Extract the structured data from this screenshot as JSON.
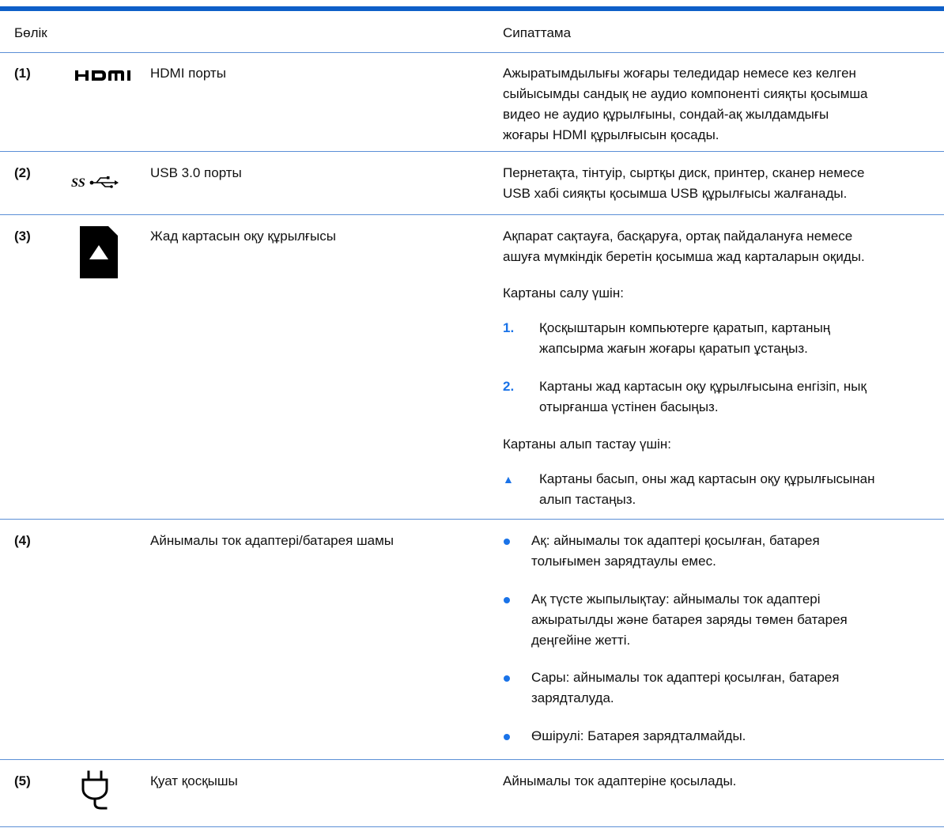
{
  "header": {
    "col_part": "Бөлік",
    "col_desc": "Сипаттама"
  },
  "rows": [
    {
      "num": "(1)",
      "icon": "hdmi-icon",
      "name": "HDMI порты",
      "desc": [
        "Ажыратымдылығы жоғары теледидар немесе кез келген",
        "сыйысымды сандық не аудио компоненті сияқты қосымша",
        "видео не аудио құрылғыны, сондай-ақ жылдамдығы",
        "жоғары HDMI құрылғысын қосады."
      ]
    },
    {
      "num": "(2)",
      "icon": "usb-superspeed-icon",
      "name": "USB 3.0 порты",
      "desc": [
        "Пернетақта, тінтуір, сыртқы диск, принтер, сканер немесе",
        "USB хабі сияқты қосымша USB құрылғысы жалғанады."
      ]
    },
    {
      "num": "(3)",
      "icon": "memory-card-icon",
      "name": "Жад картасын оқу құрылғысы",
      "desc": [
        "Ақпарат сақтауға, басқаруға, ортақ пайдалануға немесе",
        "ашуға мүмкіндік беретін қосымша жад карталарын оқиды."
      ],
      "insert_heading": "Картаны салу үшін:",
      "steps": [
        {
          "n": "1.",
          "lines": [
            "Қосқыштарын компьютерге қаратып, картаның",
            "жапсырма жағын жоғары қаратып ұстаңыз."
          ]
        },
        {
          "n": "2.",
          "lines": [
            "Картаны жад картасын оқу құрылғысына енгізіп, нық",
            "отырғанша үстінен басыңыз."
          ]
        }
      ],
      "remove_heading": "Картаны алып тастау үшін:",
      "remove_marker": "▲",
      "remove_lines": [
        "Картаны басып, оны жад картасын оқу құрылғысынан",
        "алып тастаңыз."
      ]
    },
    {
      "num": "(4)",
      "name": "Айнымалы ток адаптері/батарея шамы",
      "bullets": [
        [
          "Ақ: айнымалы ток адаптері қосылған, батарея",
          "толығымен зарядтаулы емес."
        ],
        [
          "Ақ түсте жыпылықтау: айнымалы ток адаптері",
          "ажыратылды және батарея заряды төмен батарея",
          "деңгейіне жетті."
        ],
        [
          "Сары: айнымалы ток адаптері қосылған, батарея",
          "зарядталуда."
        ],
        [
          "Өшірулі: Батарея зарядталмайды."
        ]
      ]
    },
    {
      "num": "(5)",
      "icon": "power-plug-icon",
      "name": "Қуат қосқышы",
      "desc": [
        "Айнымалы ток адаптеріне қосылады."
      ]
    }
  ],
  "colors": {
    "rule": "#0e5fc8",
    "accent": "#1a73e8"
  }
}
